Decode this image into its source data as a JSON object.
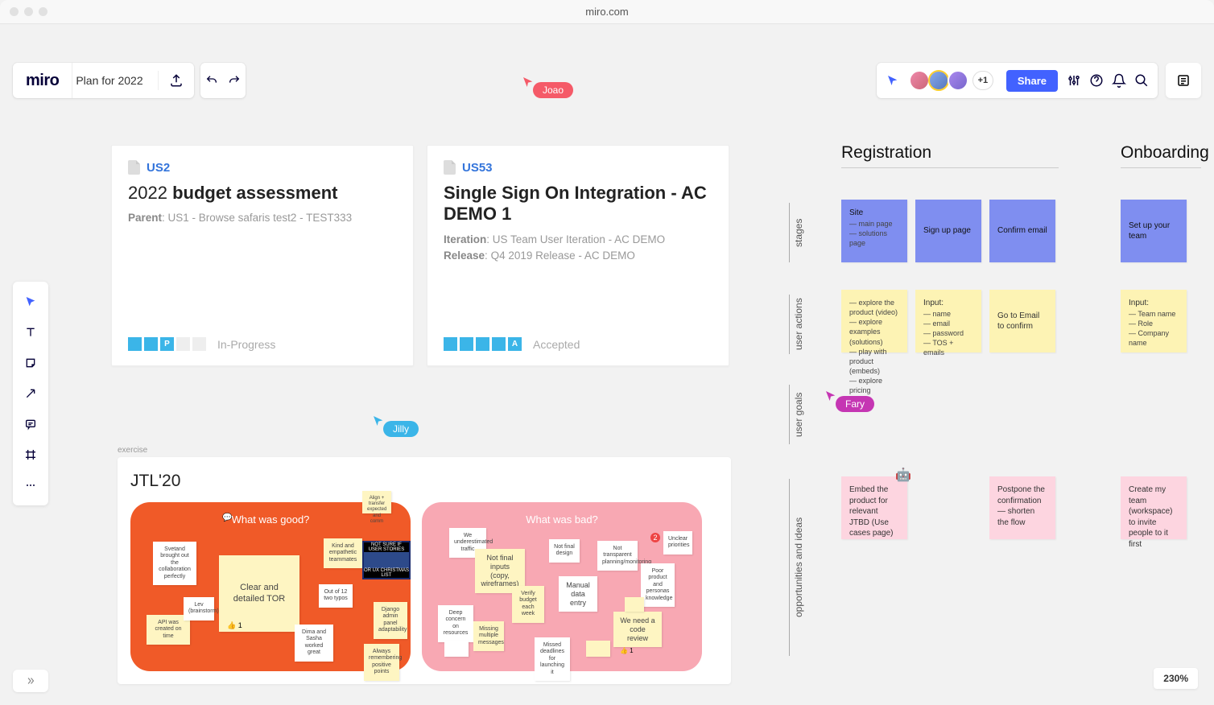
{
  "browser": {
    "url": "miro.com"
  },
  "header": {
    "logo": "miro",
    "board_title": "Plan for 2022",
    "share_label": "Share",
    "avatar_overflow": "+1"
  },
  "cursors": {
    "joao": {
      "label": "Joao",
      "color": "#f55a68"
    },
    "jilly": {
      "label": "Jilly",
      "color": "#3bb5e8"
    },
    "fary": {
      "label": "Fary",
      "color": "#c536b3"
    }
  },
  "cards": {
    "us2": {
      "id": "US2",
      "title_year": "2022",
      "title_rest": "budget assessment",
      "parent_label": "Parent",
      "parent_value": "US1 - Browse safaris test2 - TEST333",
      "status": "In-Progress",
      "progress_letter": "P"
    },
    "us53": {
      "id": "US53",
      "title": "Single Sign On Integration - AC DEMO 1",
      "iteration_label": "Iteration",
      "iteration_value": "US Team User Iteration - AC DEMO",
      "release_label": "Release",
      "release_value": "Q4 2019 Release - AC DEMO",
      "status": "Accepted",
      "progress_letter": "A"
    }
  },
  "journey": {
    "col1": "Registration",
    "col2": "Onboarding",
    "rows": {
      "stages": "stages",
      "actions": "user actions",
      "goals": "user goals",
      "ideas": "opportunities and ideas"
    },
    "stages": {
      "site": {
        "title": "Site",
        "l1": "— main page",
        "l2": "— solutions page"
      },
      "signup": "Sign up page",
      "confirm": "Confirm email",
      "team": "Set up your team"
    },
    "actions": {
      "explore": {
        "l1": "— explore the product (video)",
        "l2": "— explore examples (solutions)",
        "l3": "— play with product (embeds)",
        "l4": "— explore pricing"
      },
      "input1": {
        "title": "Input:",
        "l1": "— name",
        "l2": "— email",
        "l3": "— password",
        "l4": "— TOS + emails"
      },
      "goto": "Go to Email to confirm",
      "input2": {
        "title": "Input:",
        "l1": "— Team name",
        "l2": "— Role",
        "l3": "— Company name"
      }
    },
    "ideas": {
      "embed": "Embed the product for relevant JTBD (Use cases page)",
      "postpone": "Postpone the confirmation — shorten the flow",
      "create": "Create my team (workspace) to invite people to it first"
    }
  },
  "retro": {
    "section_label": "exercise",
    "title": "JTL'20",
    "good_title": "What was good?",
    "bad_title": "What was bad?",
    "good_notes": {
      "tor": "Clear and detailed TOR",
      "brought": "Svetand brought out the collaboration perfectly",
      "kind": "Kind and empathetic teammates",
      "api": "API was created on time",
      "lev": "Lev (brainstorm)",
      "dima": "Dima and Sasha worked great",
      "out12": "Out of 12 two typos",
      "django": "Django admin panel adaptability",
      "always": "Always remembering positive points"
    },
    "bad_notes": {
      "traffic": "We underestimated traffic",
      "inputs": "Not final inputs (copy, wireframes)",
      "manual": "Manual data entry",
      "review": "We need a code review",
      "notfinal": "Not final design",
      "planning": "Not transparent planning/monitoring",
      "poor": "Poor product and personas knowledge",
      "priorities": "Unclear priorities",
      "deep": "Deep concern on resources",
      "missed": "Missed deadlines for launching it",
      "budget": "Verify budget each week",
      "missing": "Missing multiple messages"
    },
    "meme": {
      "top": "NOT SURE IF USER STORIES",
      "bottom": "OR UX CHRISTMAS LIST"
    }
  },
  "zoom": "230%"
}
